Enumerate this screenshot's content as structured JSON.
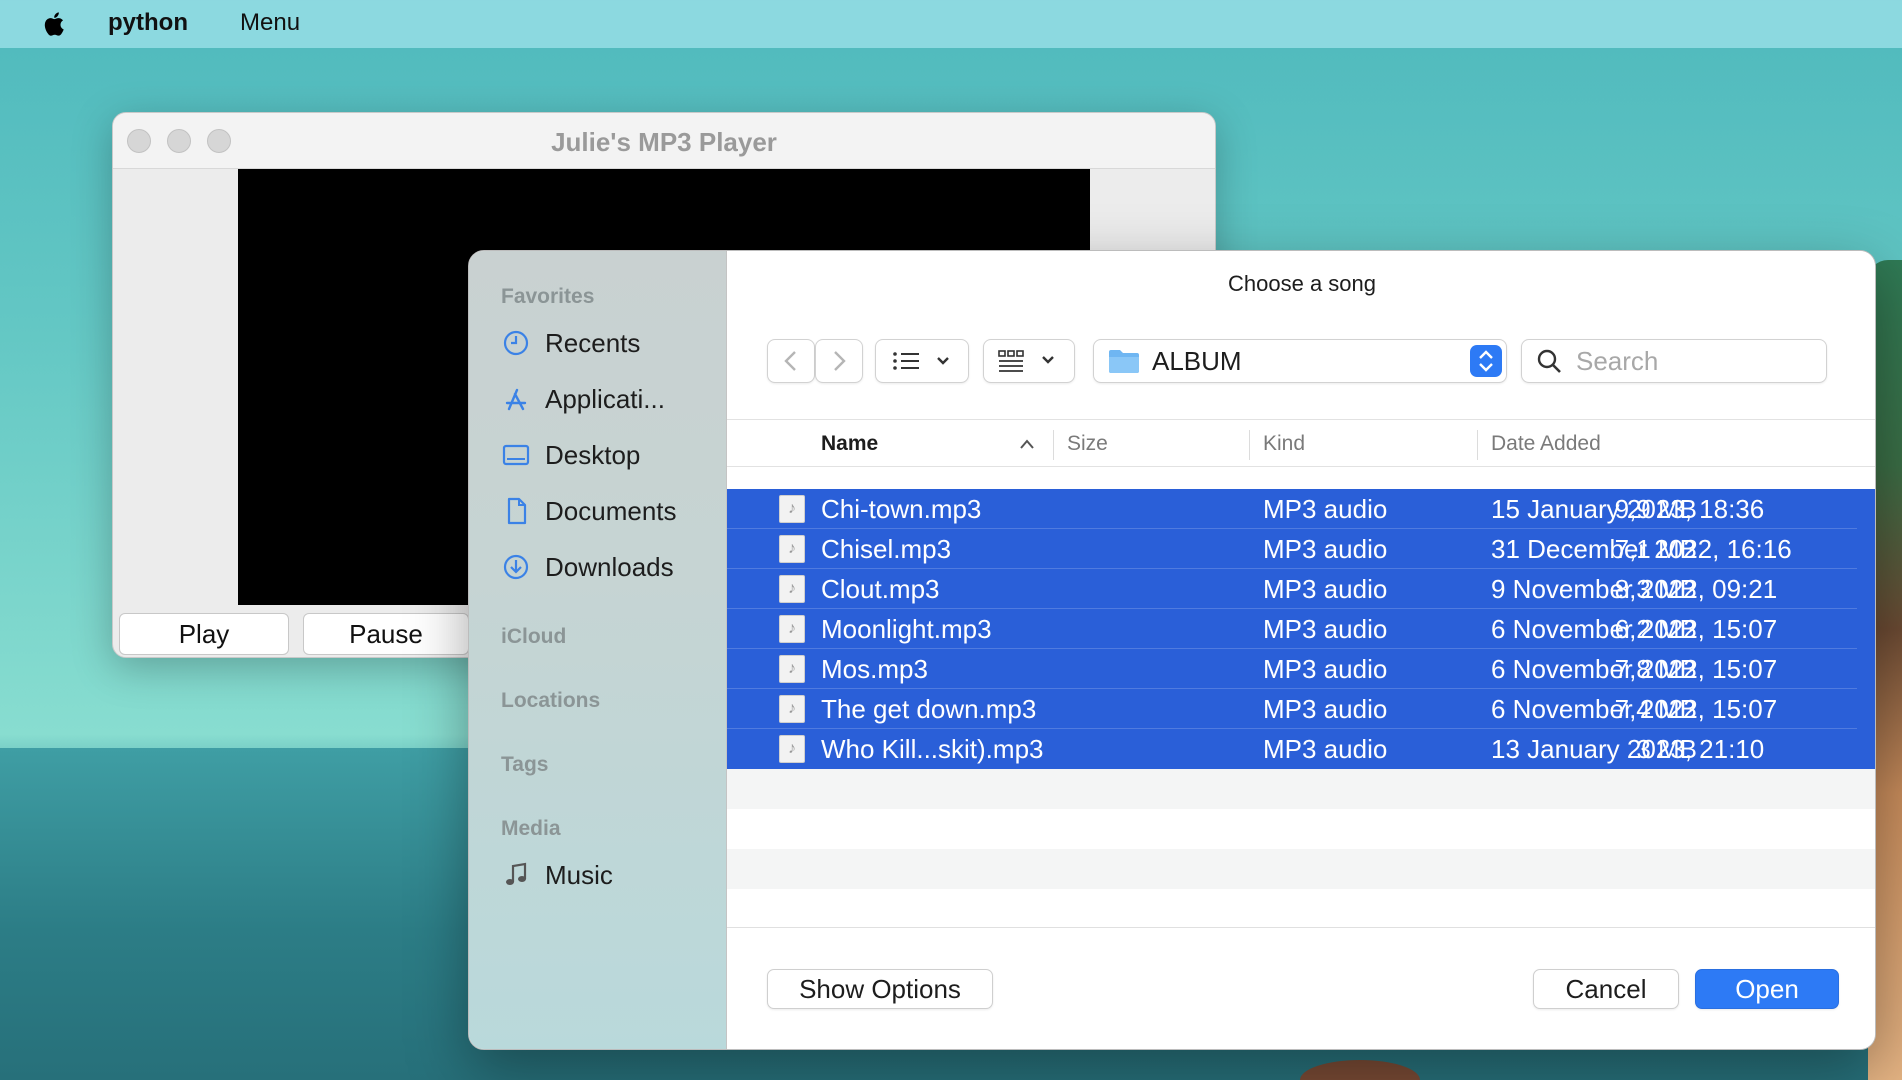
{
  "menubar": {
    "app": "python",
    "menu": "Menu"
  },
  "player": {
    "title": "Julie's MP3 Player",
    "play_label": "Play",
    "pause_label": "Pause"
  },
  "dialog": {
    "title": "Choose a song",
    "path": "ALBUM",
    "search_placeholder": "Search",
    "sidebar": {
      "favorites_heading": "Favorites",
      "favorites": [
        {
          "label": "Recents",
          "icon": "clock-icon"
        },
        {
          "label": "Applicati...",
          "icon": "applications-icon"
        },
        {
          "label": "Desktop",
          "icon": "desktop-icon"
        },
        {
          "label": "Documents",
          "icon": "document-icon"
        },
        {
          "label": "Downloads",
          "icon": "download-icon"
        }
      ],
      "icloud_heading": "iCloud",
      "locations_heading": "Locations",
      "tags_heading": "Tags",
      "media_heading": "Media",
      "media": [
        {
          "label": "Music",
          "icon": "music-note-icon"
        }
      ]
    },
    "columns": {
      "name": "Name",
      "size": "Size",
      "kind": "Kind",
      "date": "Date Added"
    },
    "files": [
      {
        "name": "Chi-town.mp3",
        "size": "9,9 MB",
        "kind": "MP3 audio",
        "date": "15 January 2023, 18:36"
      },
      {
        "name": "Chisel.mp3",
        "size": "7,1 MB",
        "kind": "MP3 audio",
        "date": "31 December 2022, 16:16"
      },
      {
        "name": "Clout.mp3",
        "size": "8,3 MB",
        "kind": "MP3 audio",
        "date": "9 November 2022, 09:21"
      },
      {
        "name": "Moonlight.mp3",
        "size": "6,2 MB",
        "kind": "MP3 audio",
        "date": "6 November 2022, 15:07"
      },
      {
        "name": "Mos.mp3",
        "size": "7,8 MB",
        "kind": "MP3 audio",
        "date": "6 November 2022, 15:07"
      },
      {
        "name": "The get down.mp3",
        "size": "7,4 MB",
        "kind": "MP3 audio",
        "date": "6 November 2022, 15:07"
      },
      {
        "name": "Who Kill...skit).mp3",
        "size": "3 MB",
        "kind": "MP3 audio",
        "date": "13 January 2023, 21:10"
      }
    ],
    "show_options_label": "Show Options",
    "cancel_label": "Cancel",
    "open_label": "Open"
  },
  "colors": {
    "accent": "#2d7af5",
    "selection": "#2a5fd8"
  }
}
